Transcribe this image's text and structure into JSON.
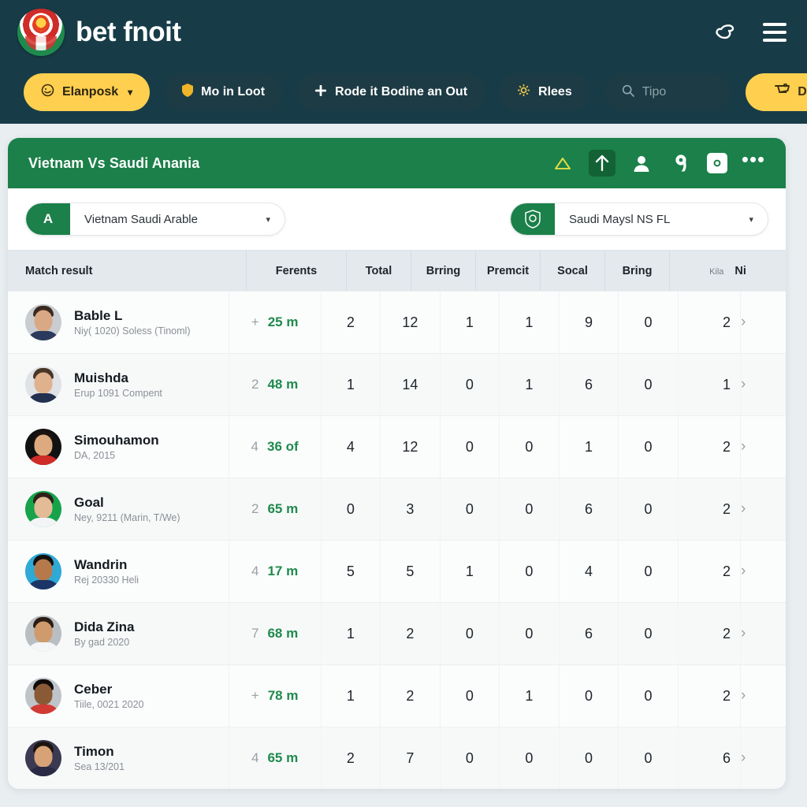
{
  "brand": {
    "name": "bet fnoit",
    "logo_icon": "football-emblem-logo"
  },
  "header": {
    "icons": [
      {
        "name": "bird-icon",
        "glyph": "✐"
      },
      {
        "name": "hamburger-menu-icon",
        "glyph": "☰"
      }
    ],
    "nav": [
      {
        "name": "elanposk",
        "label": "Elanposk",
        "icon": "smiley-circle-icon",
        "style": "yellow",
        "caret": "▾"
      },
      {
        "name": "moin-loot",
        "label": "Mo in Loot",
        "icon": "shield-icon",
        "style": "dark"
      },
      {
        "name": "rode-it-bodine-an-out",
        "label": "Rode it Bodine an Out",
        "icon": "plus-icon",
        "style": "dark"
      },
      {
        "name": "rlees",
        "label": "Rlees",
        "icon": "gear-icon",
        "style": "dark"
      }
    ],
    "search": {
      "placeholder": "Tipo",
      "value": "",
      "icon": "search-icon"
    },
    "cta": {
      "label": "Danch",
      "icon": "cart-icon"
    }
  },
  "card": {
    "title": "Vietnam Vs Saudi Anania",
    "actions": [
      {
        "name": "triangle-alert-icon",
        "glyph": "△"
      },
      {
        "name": "arrow-up-icon",
        "glyph": "↑",
        "selected": true
      },
      {
        "name": "person-icon",
        "glyph": "●"
      },
      {
        "name": "pin-icon",
        "glyph": "9"
      },
      {
        "name": "square-badge-icon",
        "glyph": "▣"
      },
      {
        "name": "more-options-icon",
        "glyph": "•••"
      }
    ],
    "dropdown_left": {
      "badge": "A",
      "badge_icon": "letter-a-badge",
      "value": "Vietnam Saudi Arable",
      "caret": "▾"
    },
    "dropdown_right": {
      "badge": "",
      "badge_icon": "team-crest-icon",
      "value": "Saudi Maysl NS FL",
      "caret": "▾"
    }
  },
  "table": {
    "columns": [
      {
        "key": "player",
        "label": "Match result"
      },
      {
        "key": "time",
        "label": "Ferents"
      },
      {
        "key": "n1",
        "label": "Total"
      },
      {
        "key": "n2",
        "label": "Brring"
      },
      {
        "key": "n3",
        "label": "Premcit"
      },
      {
        "key": "n4",
        "label": "Socal"
      },
      {
        "key": "n5",
        "label": "Bring"
      }
    ],
    "last_column": {
      "small_label": "Kila",
      "label": "Ni"
    },
    "rows": [
      {
        "name": "Bable L",
        "meta": "Niy( 1020) Soless (Tinoml)",
        "time_pre": "+",
        "time": "25 m",
        "n1": "2",
        "n2": "12",
        "n3": "1",
        "n4": "1",
        "n5": "9",
        "n6": "0",
        "n7": "2",
        "avatar": {
          "bg": "#c9cdd2",
          "skin": "#d9a884",
          "hair": "#3b2a1e",
          "shirt": "#2b3a5c"
        }
      },
      {
        "name": "Muishda",
        "meta": "Erup 1091 Compent",
        "time_pre": "2",
        "time": "48 m",
        "n1": "1",
        "n2": "14",
        "n3": "0",
        "n4": "1",
        "n5": "6",
        "n6": "0",
        "n7": "1",
        "avatar": {
          "bg": "#dfe2e6",
          "skin": "#e0b18d",
          "hair": "#4a3525",
          "shirt": "#23304f"
        }
      },
      {
        "name": "Simouhamon",
        "meta": "DA, 2015",
        "time_pre": "4",
        "time": "36 of",
        "n1": "4",
        "n2": "12",
        "n3": "0",
        "n4": "0",
        "n5": "1",
        "n6": "0",
        "n7": "2",
        "avatar": {
          "bg": "#111111",
          "skin": "#dda97f",
          "hair": "#1b1310",
          "shirt": "#cf2b28"
        }
      },
      {
        "name": "Goal",
        "meta": "Ney, 9211 (Marin, T/We)",
        "time_pre": "2",
        "time": "65 m",
        "n1": "0",
        "n2": "3",
        "n3": "0",
        "n4": "0",
        "n5": "6",
        "n6": "0",
        "n7": "2",
        "avatar": {
          "bg": "#16a34a",
          "skin": "#e3bb97",
          "hair": "#2e2118",
          "shirt": "#f2f4f6"
        }
      },
      {
        "name": "Wandrin",
        "meta": "Rej 20330 Heli",
        "time_pre": "4",
        "time": "17 m",
        "n1": "5",
        "n2": "5",
        "n3": "1",
        "n4": "0",
        "n5": "4",
        "n6": "0",
        "n7": "2",
        "avatar": {
          "bg": "#2fa9d6",
          "skin": "#b5794b",
          "hair": "#15100c",
          "shirt": "#1c3566"
        }
      },
      {
        "name": "Dida Zina",
        "meta": "By gad 2020",
        "time_pre": "7",
        "time": "68 m",
        "n1": "1",
        "n2": "2",
        "n3": "0",
        "n4": "0",
        "n5": "6",
        "n6": "0",
        "n7": "2",
        "avatar": {
          "bg": "#b9bec3",
          "skin": "#cf9a6c",
          "hair": "#2a1d14",
          "shirt": "#f4f5f6"
        }
      },
      {
        "name": "Ceber",
        "meta": "Tiile, 0021 2020",
        "time_pre": "+",
        "time": "78 m",
        "n1": "1",
        "n2": "2",
        "n3": "0",
        "n4": "1",
        "n5": "0",
        "n6": "0",
        "n7": "2",
        "avatar": {
          "bg": "#bfc4c9",
          "skin": "#8a5a37",
          "hair": "#100b08",
          "shirt": "#d23b33"
        }
      },
      {
        "name": "Timon",
        "meta": "Sea 13/201",
        "time_pre": "4",
        "time": "65 m",
        "n1": "2",
        "n2": "7",
        "n3": "0",
        "n4": "0",
        "n5": "0",
        "n6": "0",
        "n7": "6",
        "avatar": {
          "bg": "#3c3a52",
          "skin": "#d6a276",
          "hair": "#1c140e",
          "shirt": "#2b2a45"
        }
      }
    ],
    "row_arrow": "›"
  },
  "colors": {
    "header_bg": "#173c47",
    "accent_yellow": "#ffd04f",
    "green": "#1b8049",
    "page_bg": "#e9eef1",
    "time_green": "#1f8a4d"
  }
}
